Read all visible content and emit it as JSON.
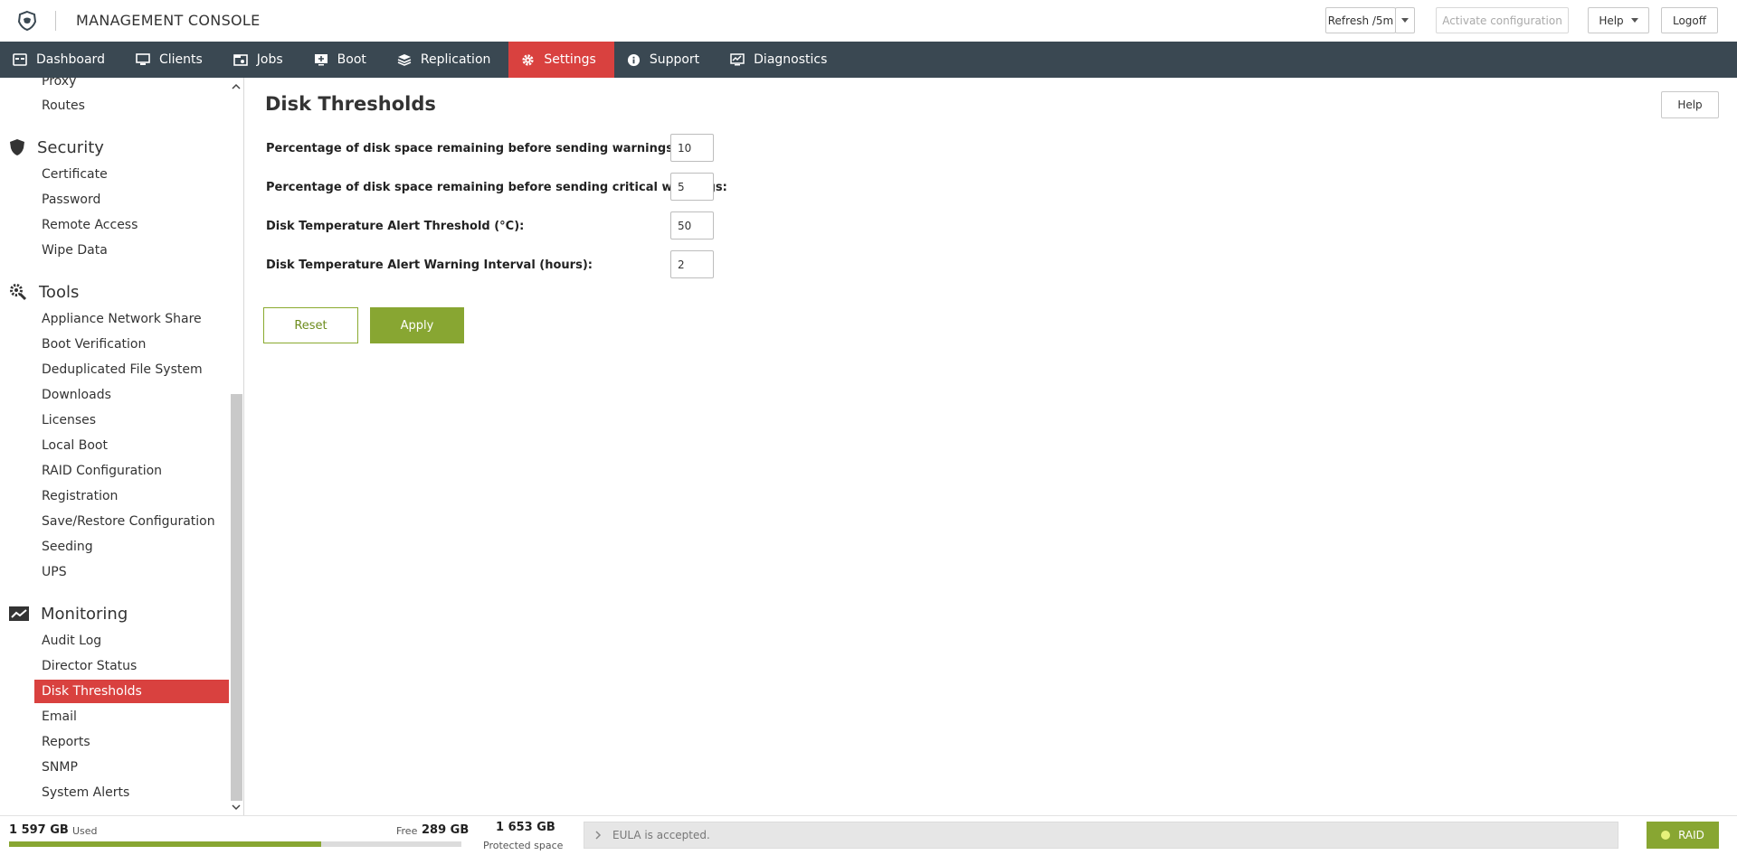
{
  "header": {
    "title": "MANAGEMENT CONSOLE",
    "refresh_label": "Refresh /5m",
    "activate_label": "Activate configuration",
    "help_label": "Help",
    "logoff_label": "Logoff"
  },
  "nav": {
    "items": [
      {
        "label": "Dashboard",
        "icon": "dashboard-icon"
      },
      {
        "label": "Clients",
        "icon": "monitor-icon"
      },
      {
        "label": "Jobs",
        "icon": "jobs-icon"
      },
      {
        "label": "Boot",
        "icon": "boot-icon"
      },
      {
        "label": "Replication",
        "icon": "layers-icon"
      },
      {
        "label": "Settings",
        "icon": "gear-icon",
        "active": true
      },
      {
        "label": "Support",
        "icon": "info-icon"
      },
      {
        "label": "Diagnostics",
        "icon": "diagnostics-icon"
      }
    ],
    "active_color": "#d9413f",
    "bar_color": "#3a4852"
  },
  "sidebar": {
    "top_items": [
      "Proxy",
      "Routes"
    ],
    "security": {
      "title": "Security",
      "icon": "shield-icon",
      "items": [
        "Certificate",
        "Password",
        "Remote Access",
        "Wipe Data"
      ]
    },
    "tools": {
      "title": "Tools",
      "icon": "tools-gear-icon",
      "items": [
        "Appliance Network Share",
        "Boot Verification",
        "Deduplicated File System",
        "Downloads",
        "Licenses",
        "Local Boot",
        "RAID Configuration",
        "Registration",
        "Save/Restore Configuration",
        "Seeding",
        "UPS"
      ]
    },
    "monitoring": {
      "title": "Monitoring",
      "icon": "chart-line-icon",
      "items": [
        "Audit Log",
        "Director Status",
        "Disk Thresholds",
        "Email",
        "Reports",
        "SNMP",
        "System Alerts"
      ],
      "active": "Disk Thresholds"
    }
  },
  "main": {
    "title": "Disk Thresholds",
    "help_label": "Help",
    "fields": [
      {
        "label": "Percentage of disk space remaining before sending warnings:",
        "value": "10"
      },
      {
        "label": "Percentage of disk space remaining before sending critical warnings:",
        "value": "5"
      },
      {
        "label": "Disk Temperature Alert Threshold (°C):",
        "value": "50"
      },
      {
        "label": "Disk Temperature Alert Warning Interval (hours):",
        "value": "2"
      }
    ],
    "reset_label": "Reset",
    "apply_label": "Apply",
    "accent_color": "#88a632"
  },
  "footer": {
    "used_value": "1 597 GB",
    "used_label": "Used",
    "free_label": "Free",
    "free_value": "289 GB",
    "used_fraction": 0.69,
    "protected_value": "1 653 GB",
    "protected_label": "Protected space",
    "status_text": "EULA is accepted.",
    "raid_label": "RAID",
    "raid_status_color": "#e6f27a"
  }
}
